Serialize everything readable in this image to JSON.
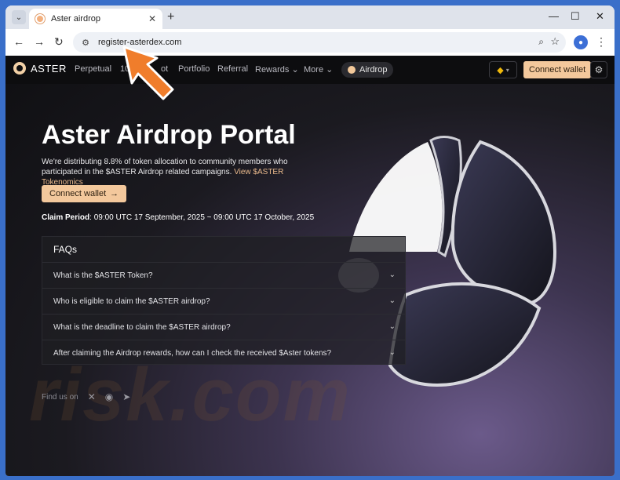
{
  "browser": {
    "tab_title": "Aster airdrop",
    "url": "register-asterdex.com"
  },
  "nav": {
    "brand": "ASTER",
    "links": [
      "Perpetual",
      "10",
      "ot",
      "Portfolio",
      "Referral",
      "Rewards",
      "More"
    ],
    "airdrop": "Airdrop",
    "connect": "Connect wallet"
  },
  "hero": {
    "title": "Aster Airdrop Portal",
    "desc": "We're distributing 8.8% of token allocation to community members who participated in the $ASTER Airdrop related campaigns.",
    "desc_link": "View $ASTER Tokenomics",
    "connect": "Connect wallet",
    "claim_label": "Claim Period",
    "claim_value": ": 09:00 UTC 17 September, 2025 ~ 09:00 UTC 17 October, 2025"
  },
  "faq": {
    "title": "FAQs",
    "items": [
      "What is the $ASTER Token?",
      "Who is eligible to claim the $ASTER airdrop?",
      "What is the deadline to claim the $ASTER airdrop?",
      "After claiming the Airdrop rewards, how can I check the received $Aster tokens?"
    ]
  },
  "footer": {
    "find_us": "Find us on"
  },
  "watermark": "risk.com",
  "colors": {
    "accent": "#f3c89c",
    "arrow": "#f07d2b"
  }
}
